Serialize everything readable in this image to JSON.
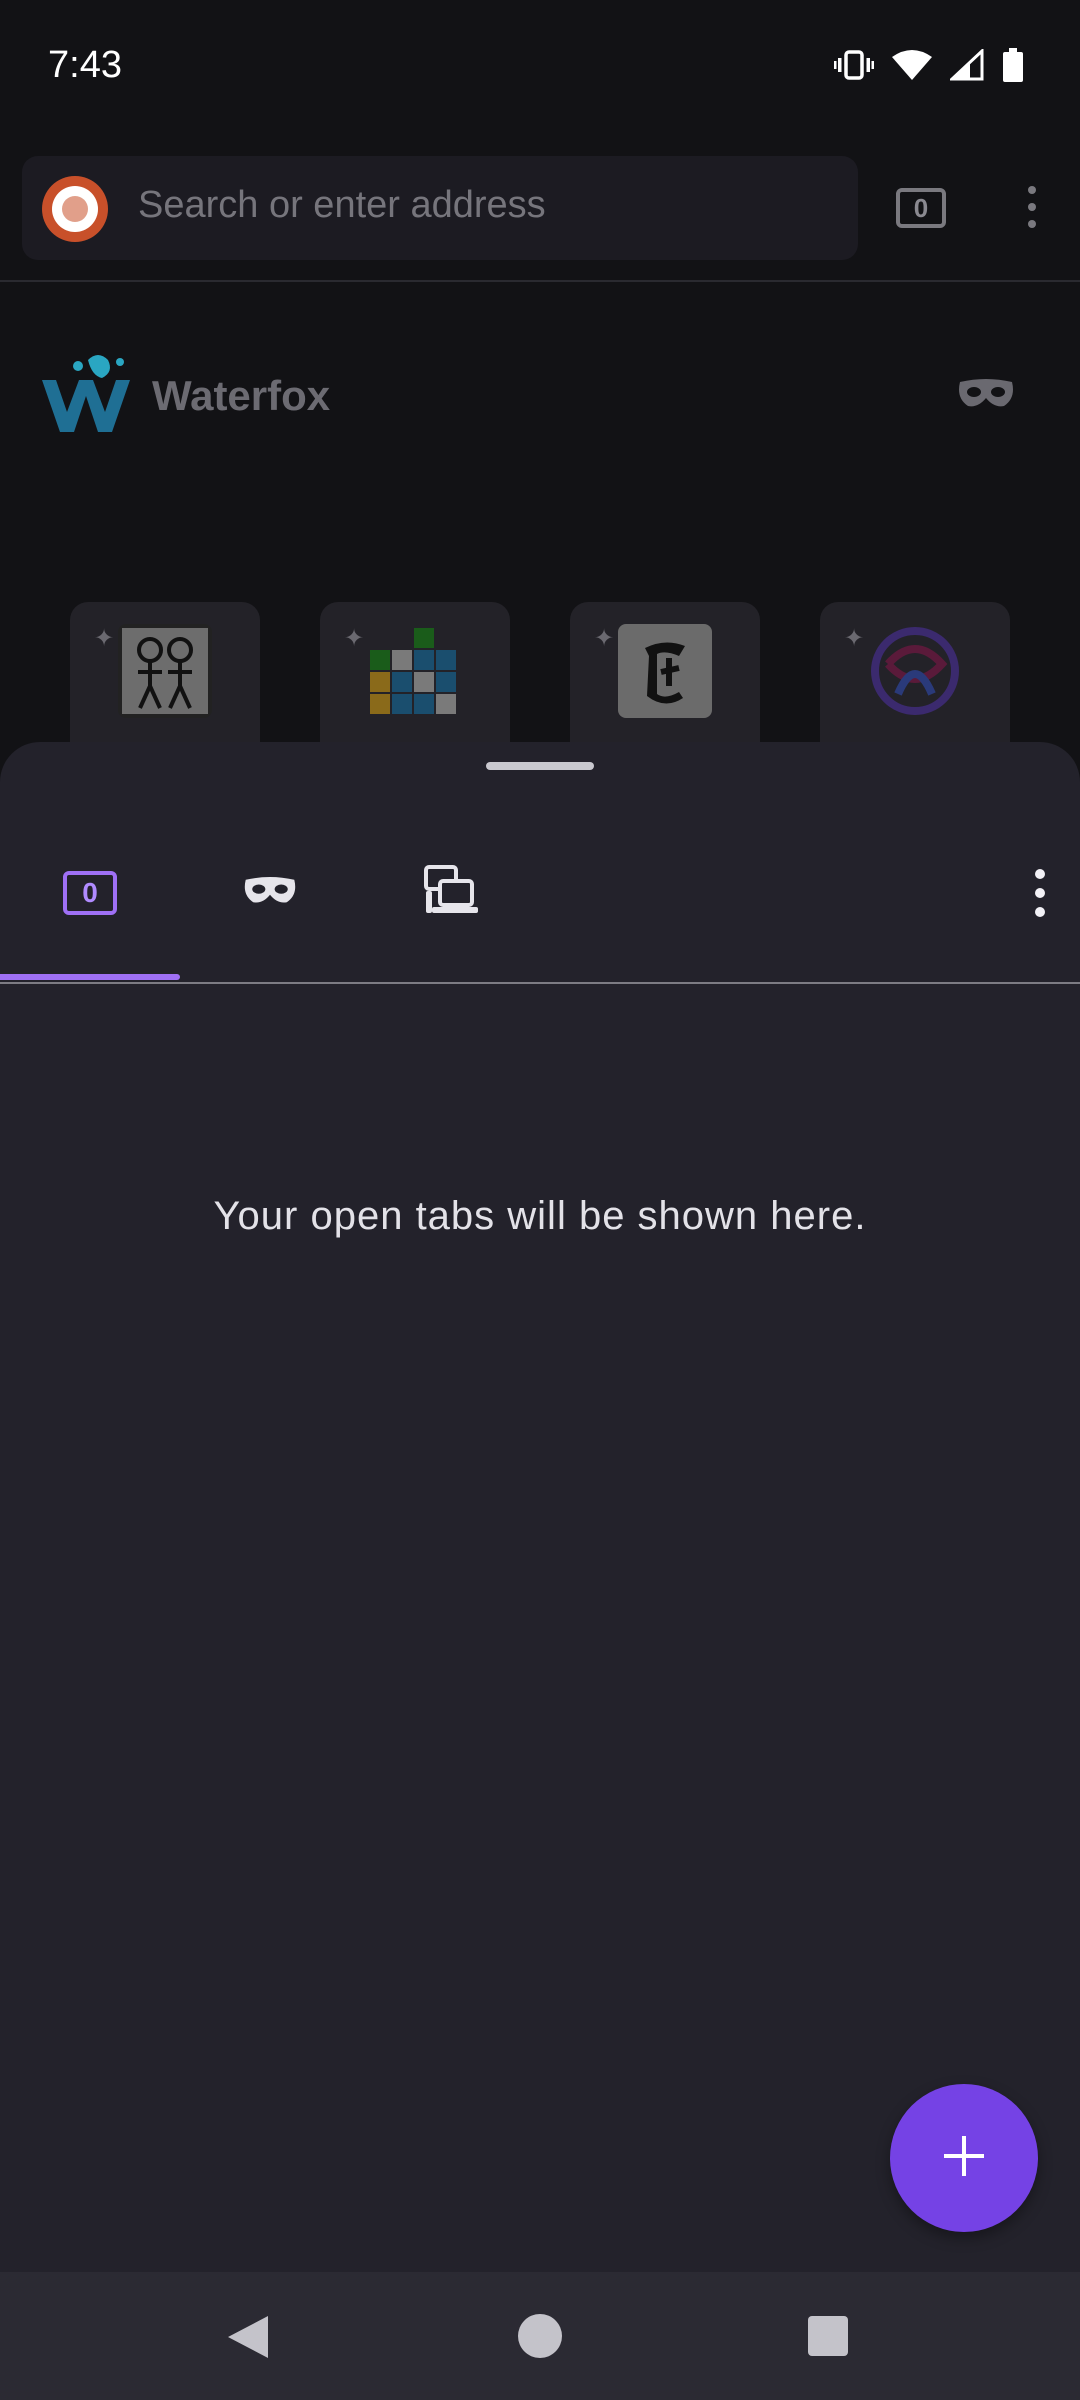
{
  "status_bar": {
    "time": "7:43"
  },
  "toolbar": {
    "search_placeholder": "Search or enter address",
    "tab_count": "0"
  },
  "home": {
    "title": "Waterfox"
  },
  "tabs_tray": {
    "normal_tab_count": "0",
    "empty_message": "Your open tabs will be shown here."
  },
  "colors": {
    "accent": "#9f70f5",
    "fab": "#7542e5",
    "sheet_background": "#23222b"
  },
  "icons": {
    "tabs_normal": "tab-counter-icon",
    "tabs_private": "private-mask-icon",
    "tabs_synced": "synced-devices-icon",
    "add": "plus-icon"
  }
}
